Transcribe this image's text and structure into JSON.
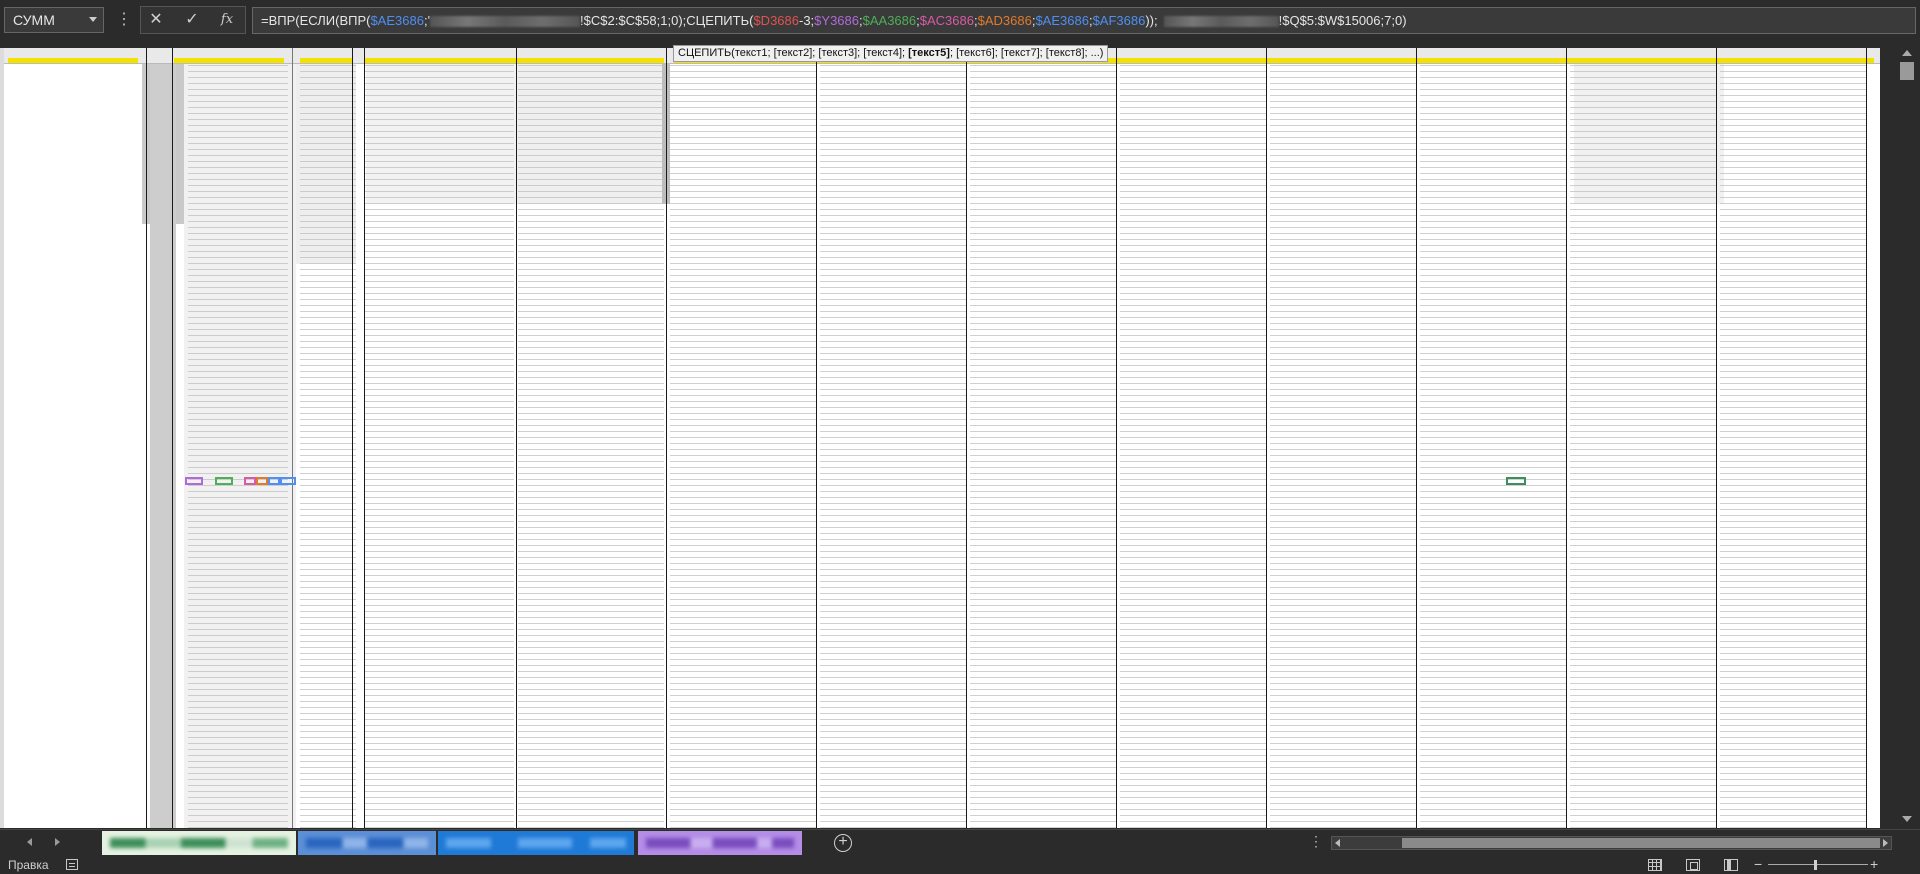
{
  "formula_bar": {
    "name_box": "СУММ",
    "more_icon": "vertical-dots-icon",
    "cancel_icon": "✕",
    "confirm_icon": "✓",
    "insert_function_label": "fx",
    "formula": {
      "p1": "=ВПР(ЕСЛИ(ВПР(",
      "p2": "$AE3686",
      "p3": ";'",
      "p4": "!$C$2:$C$58;1;0);СЦЕПИТЬ(",
      "p5": "$D3686",
      "p6": "-3;",
      "p7": "$Y3686",
      "p8": ";",
      "p9": "$AA3686",
      "p10": ";",
      "p11": "$AC3686",
      "p12": ";",
      "p13": "$AD3686",
      "p14": ";",
      "p15": "$AE3686",
      "p16": ";",
      "p17": "$AF3686",
      "p18": "));",
      "p19": "!$Q$5:$W$15006;7;0)"
    },
    "colors": {
      "blue": "#4f8ff2",
      "red": "#e05252",
      "purple": "#b06ad9",
      "green": "#4fae5a",
      "pink": "#d95aa6",
      "orange": "#e07a2f",
      "teal": "#3aa3b8"
    }
  },
  "tooltip": {
    "pre": "СЦЕПИТЬ(текст1; [текст2]; [текст3]; [текст4]; ",
    "bold": "[текст5]",
    "post": "; [текст6]; [текст7]; [текст8]; ...)"
  },
  "sheet_tabs": [
    {
      "color": "#e6f2e1",
      "accent": "#3d8f5a"
    },
    {
      "color": "#5b8fd6",
      "accent": "#2a66bf"
    },
    {
      "color": "#1f7ad6",
      "accent": "#0f5fb0"
    },
    {
      "color": "#b38de6",
      "accent": "#7a4dbf"
    }
  ],
  "status": {
    "mode": "Правка"
  }
}
